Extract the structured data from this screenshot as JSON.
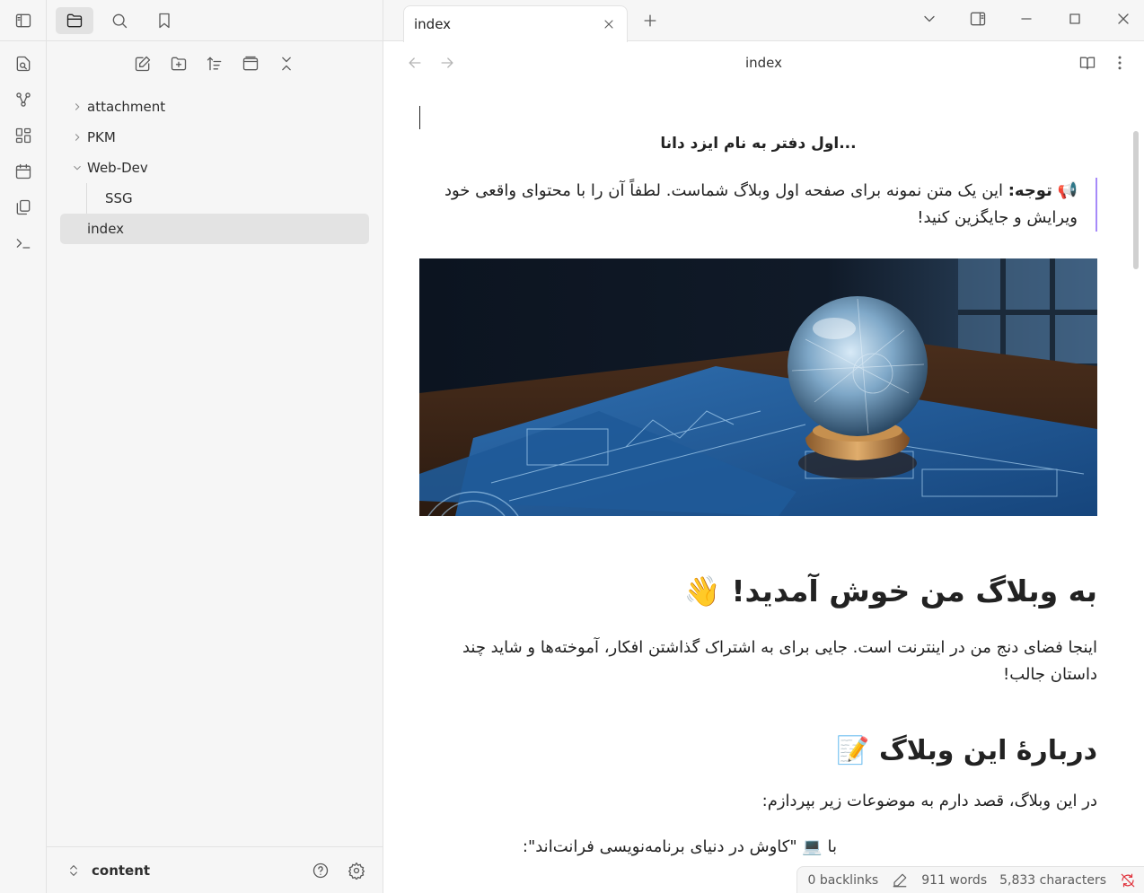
{
  "ribbon": {
    "icons": [
      "sidebar-toggle-icon",
      "search-replace-icon",
      "graph-icon",
      "canvas-icon",
      "calendar-icon",
      "templates-icon",
      "terminal-icon"
    ]
  },
  "sidebar": {
    "tabs": [
      "folder-icon",
      "search-icon",
      "bookmark-icon"
    ],
    "actions": [
      "new-note-icon",
      "new-folder-icon",
      "sort-icon",
      "collapse-view-icon",
      "collapse-all-icon"
    ],
    "tree": [
      {
        "label": "attachment"
      },
      {
        "label": "PKM"
      },
      {
        "label": "Web-Dev"
      },
      {
        "label": "SSG"
      },
      {
        "label": "index"
      }
    ],
    "vault_name": "content"
  },
  "tab": {
    "title": "index"
  },
  "view": {
    "title": "index"
  },
  "doc": {
    "intro": "...اول دفتر به نام ایزد دانا",
    "callout_label": "توجه:",
    "callout_text": " این یک متن نمونه برای صفحه اول وبلاگ شماست. لطفاً آن را با محتوای واقعی خود ویرایش و جایگزین کنید!",
    "callout_emoji": "📢",
    "h1": "به وبلاگ من خوش آمدید!",
    "h1_emoji": "👋",
    "p1": "اینجا فضای دنج من در اینترنت است. جایی برای به اشتراک گذاشتن افکار، آموخته‌ها و شاید چند داستان جالب!",
    "h2": "دربارهٔ این وبلاگ",
    "h2_emoji": "📝",
    "p2": "در این وبلاگ، قصد دارم به موضوعات زیر بپردازم:",
    "p3": "با 💻 \"کاوش در دنیای برنامه‌نویسی فرانت‌اند\":"
  },
  "status": {
    "backlinks": "0 backlinks",
    "words": "911 words",
    "characters": "5,833 characters"
  },
  "colors": {
    "accent": "#a68af9",
    "sync_error": "#e0303a"
  }
}
